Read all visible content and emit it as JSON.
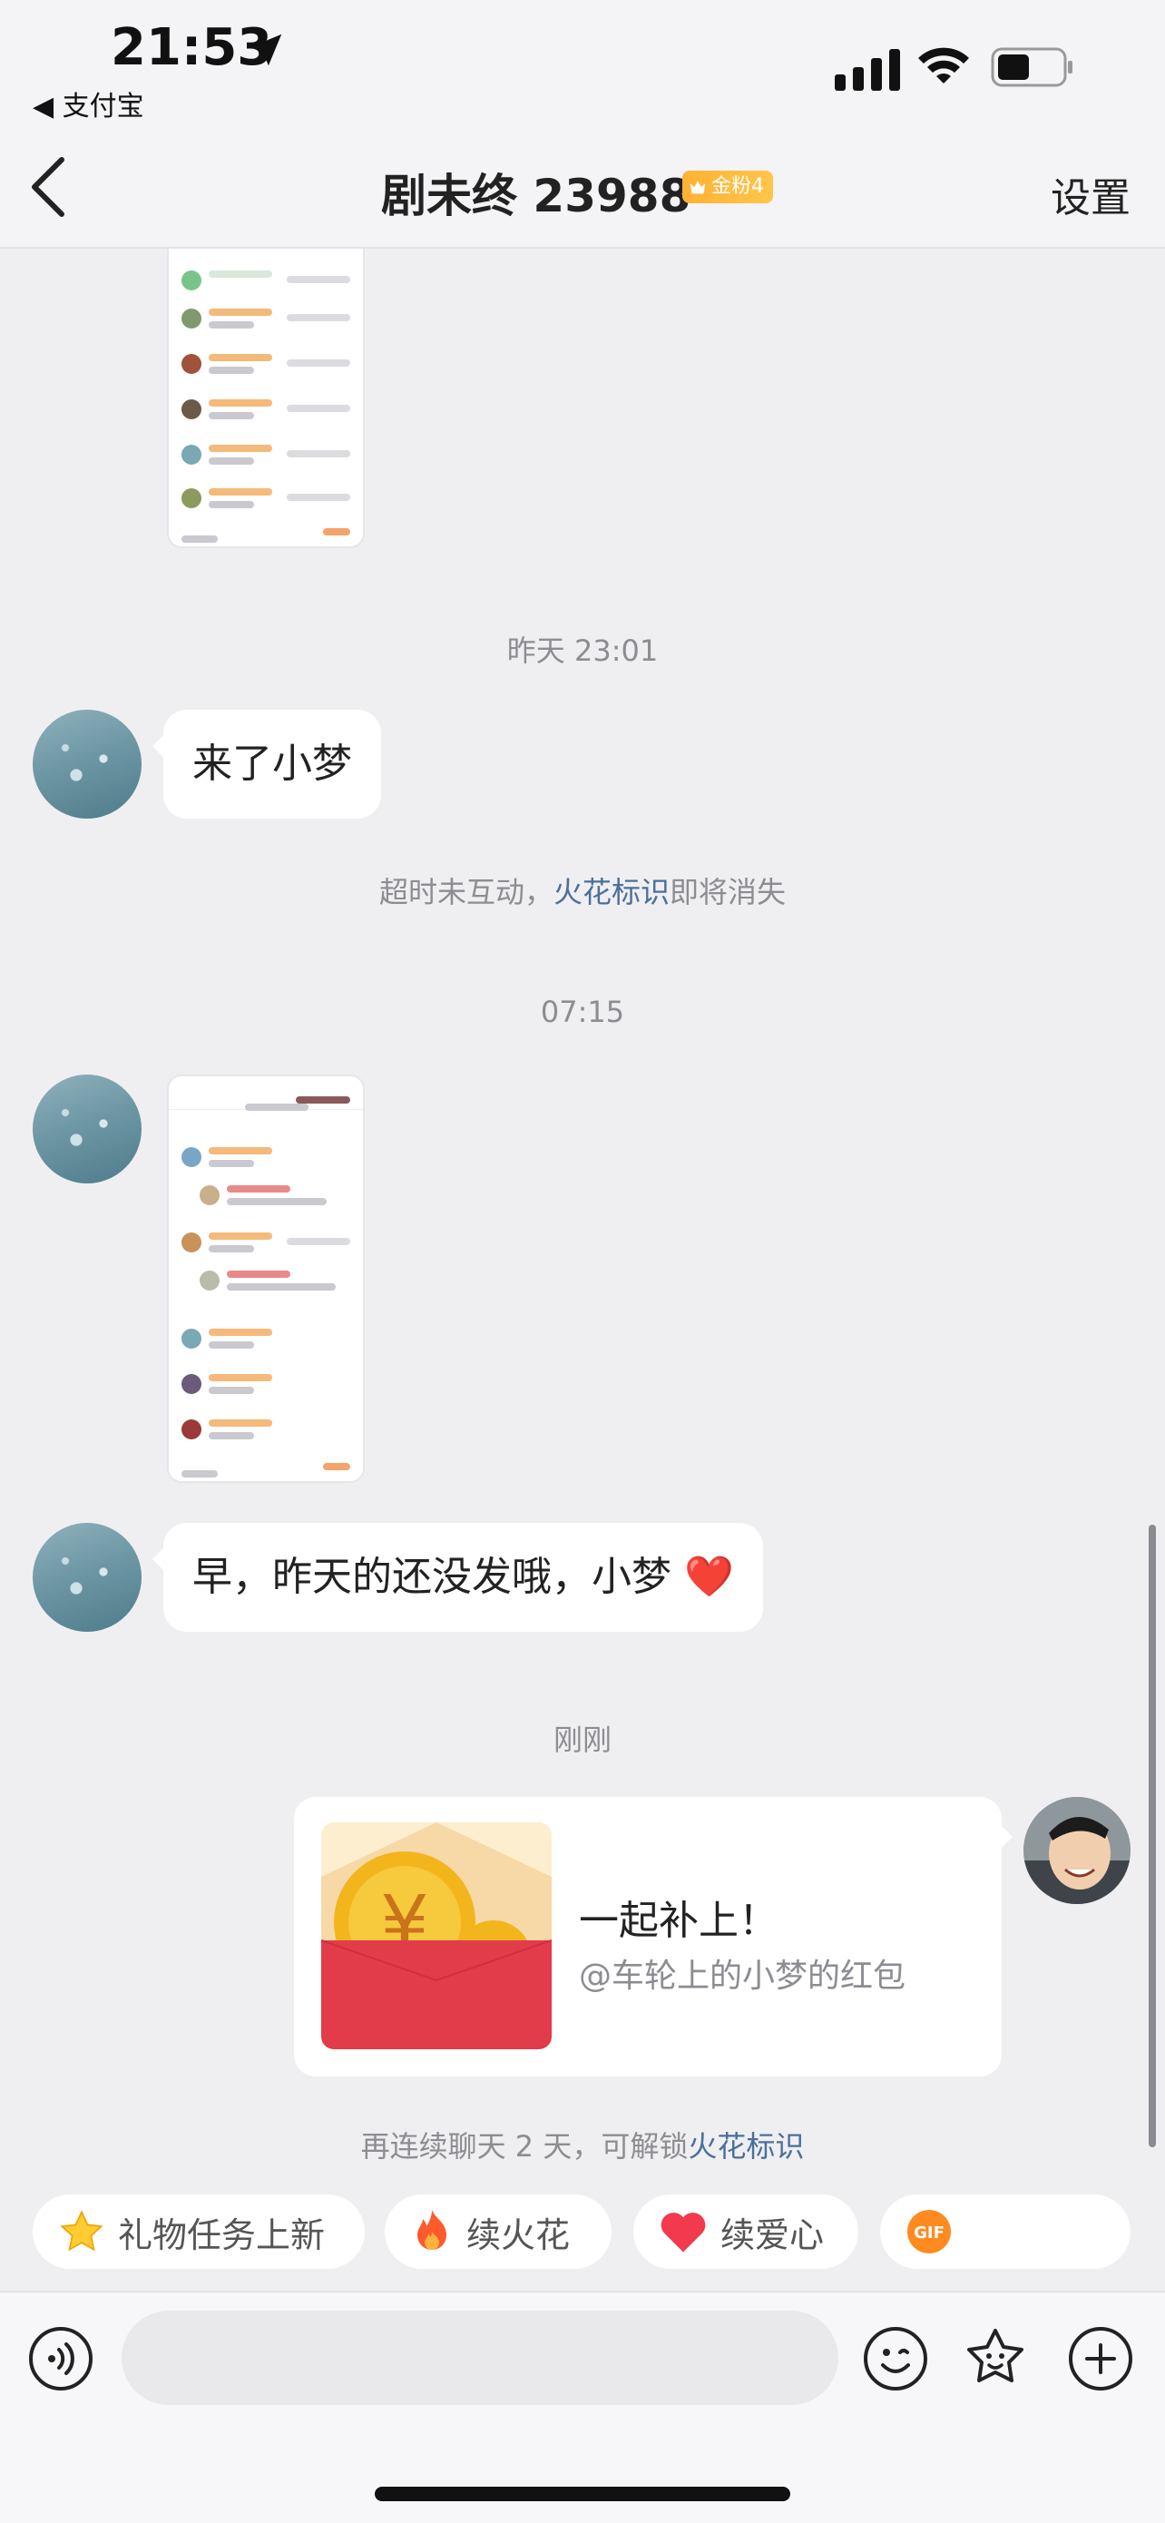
{
  "status_bar": {
    "time": "21:53",
    "back_app": "◀ 支付宝"
  },
  "nav": {
    "title": "剧未终 23988",
    "fan_badge": "金粉4",
    "settings": "设置"
  },
  "chat": {
    "stamp_1": "昨天 23:01",
    "msg_1": "来了小梦",
    "system_1_prefix": "超时未互动，",
    "system_1_link": "火花标识",
    "system_1_suffix": "即将消失",
    "stamp_2": "07:15",
    "msg_2": "早，昨天的还没发哦，小梦",
    "msg_2_emoji": "❤️",
    "stamp_3": "刚刚",
    "red_packet": {
      "title": "一起补上！",
      "subtitle": "@车轮上的小梦的红包"
    },
    "hint_prefix": "再连续聊天 2 天，可解锁",
    "hint_link": "火花标识"
  },
  "quick_actions": [
    {
      "label": "礼物任务上新",
      "icon": "star-icon"
    },
    {
      "label": "续火花",
      "icon": "fire-icon"
    },
    {
      "label": "续爱心",
      "icon": "heart-icon"
    },
    {
      "label": "",
      "icon": "gif-icon",
      "icon_text": "GIF"
    }
  ],
  "input": {
    "placeholder": ""
  },
  "colors": {
    "accent_link": "#4b6f9b",
    "red_packet": "#e23b4a",
    "badge": "#ffb233"
  }
}
